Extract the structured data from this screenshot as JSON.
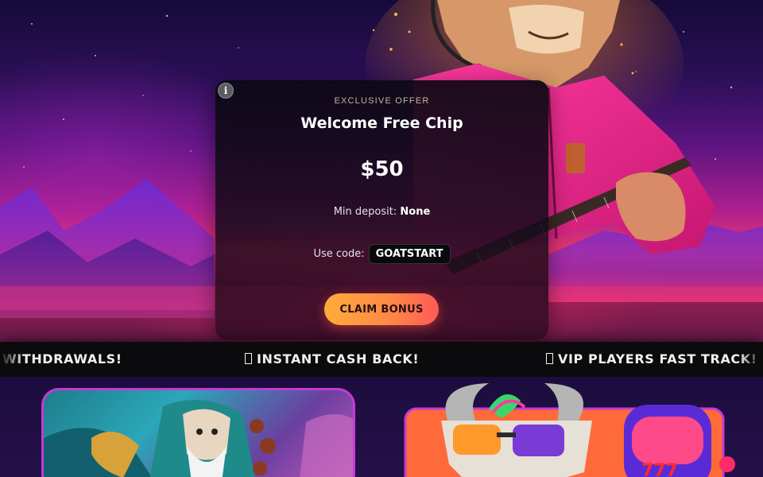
{
  "offer": {
    "info_label": "i",
    "eyebrow": "EXCLUSIVE OFFER",
    "title": "Welcome Free Chip",
    "amount": "$50",
    "min_deposit_label": "Min deposit:",
    "min_deposit_value": "None",
    "code_label": "Use code:",
    "code_value": "GOATSTART",
    "claim_label": "CLAIM BONUS"
  },
  "marquee": {
    "items": [
      "WITHDRAWALS!",
      "INSTANT CASH BACK!",
      "VIP PLAYERS FAST TRACK!"
    ]
  },
  "colors": {
    "accent_orange": "#ffab3c",
    "accent_red": "#ff5a56",
    "card_border_purple": "#c43bd6",
    "marquee_bg": "#0b0b0d"
  },
  "icons": {
    "info": "info-icon",
    "marquee_glyph": "missing-glyph-icon"
  }
}
